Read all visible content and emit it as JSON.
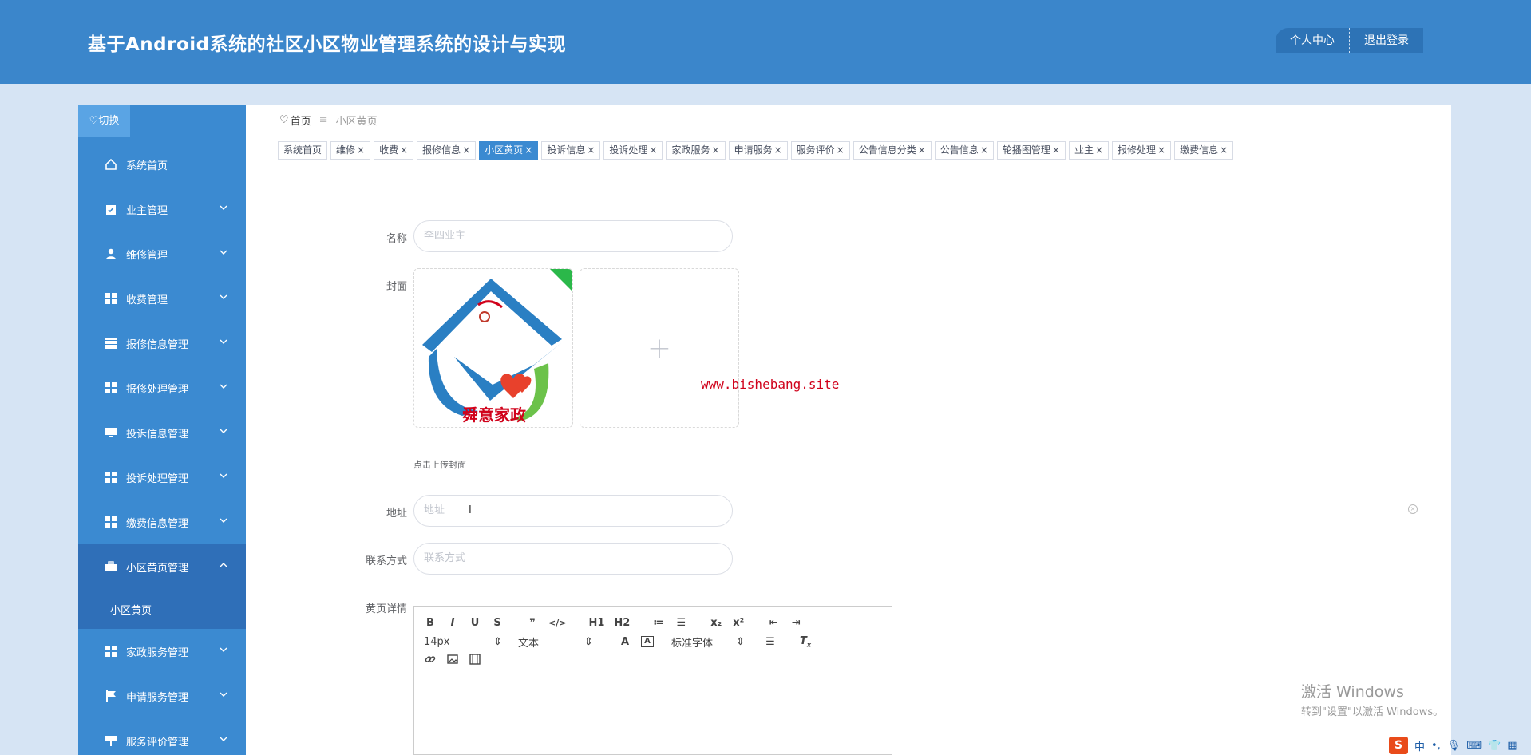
{
  "header": {
    "title": "基于Android系统的社区小区物业管理系统的设计与实现",
    "personal_center": "个人中心",
    "logout": "退出登录"
  },
  "sidebar": {
    "switch_label": "切换",
    "items": [
      {
        "label": "系统首页",
        "icon": "home-icon"
      },
      {
        "label": "业主管理",
        "icon": "clipboard-icon"
      },
      {
        "label": "维修管理",
        "icon": "user-icon"
      },
      {
        "label": "收费管理",
        "icon": "grid-icon"
      },
      {
        "label": "报修信息管理",
        "icon": "table-icon"
      },
      {
        "label": "报修处理管理",
        "icon": "grid-icon"
      },
      {
        "label": "投诉信息管理",
        "icon": "monitor-icon"
      },
      {
        "label": "投诉处理管理",
        "icon": "grid-icon"
      },
      {
        "label": "缴费信息管理",
        "icon": "grid-icon"
      },
      {
        "label": "小区黄页管理",
        "icon": "briefcase-icon"
      },
      {
        "label": "小区黄页",
        "icon": ""
      },
      {
        "label": "家政服务管理",
        "icon": "grid-icon"
      },
      {
        "label": "申请服务管理",
        "icon": "flag-icon"
      },
      {
        "label": "服务评价管理",
        "icon": "sign-icon"
      }
    ]
  },
  "breadcrumb": {
    "home": "首页",
    "current": "小区黄页"
  },
  "tags": [
    "系统首页",
    "维修",
    "收费",
    "报修信息",
    "小区黄页",
    "投诉信息",
    "投诉处理",
    "家政服务",
    "申请服务",
    "服务评价",
    "公告信息分类",
    "公告信息",
    "轮播图管理",
    "业主",
    "报修处理",
    "缴费信息"
  ],
  "tag_close": "×",
  "form": {
    "name_label": "名称",
    "name_value": "李四业主",
    "cover_label": "封面",
    "upload_plus": "+",
    "upload_hint": "点击上传封面",
    "logo_text": "舜意家政",
    "address_label": "地址",
    "address_placeholder": "地址",
    "contact_label": "联系方式",
    "contact_placeholder": "联系方式",
    "detail_label": "黄页详情"
  },
  "watermark": "www.bishebang.site",
  "editor": {
    "row1": [
      "B",
      "I",
      "U",
      "S",
      "❞",
      "</>",
      "H1",
      "H2",
      "≔",
      "☰",
      "x₂",
      "x²",
      "⇤",
      "⇥"
    ],
    "font_size": "14px",
    "paragraph": "文本",
    "font_family": "标准字体",
    "row3": [
      "link-icon",
      "image-icon",
      "video-icon"
    ]
  },
  "windows": {
    "activate": "激活 Windows",
    "activate_hint": "转到\"设置\"以激活 Windows。"
  },
  "tray": {
    "ime": "S",
    "lang": "中"
  },
  "colors": {
    "header": "#3b86cb",
    "sidebar": "#3b8ad1",
    "active": "#2f6fb8",
    "watermark": "#d0021b"
  }
}
